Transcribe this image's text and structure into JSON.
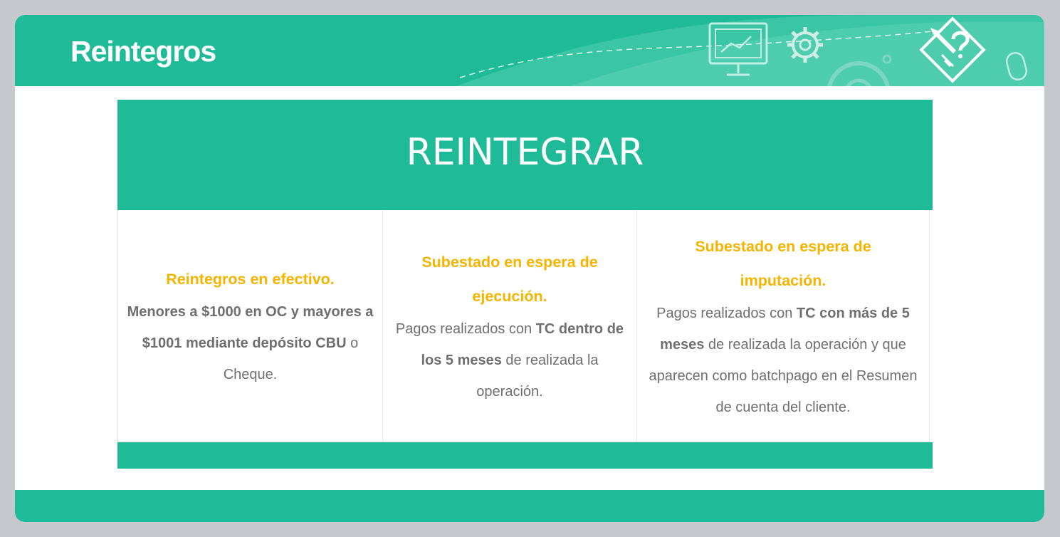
{
  "header": {
    "brand": "Reintegros",
    "logo_icon": "pencil-question-diamond-icon",
    "decor_icons": [
      "monitor-chart-icon",
      "gear-icon",
      "cog-large-icon",
      "mouse-icon"
    ]
  },
  "card": {
    "title": "REINTEGRAR",
    "columns": [
      {
        "title": "Reintegros en efectivo.",
        "body": [
          {
            "text": "Menores a $1000 en OC y mayores a $1001 mediante depósito CBU",
            "bold": true
          },
          {
            "text": " o Cheque.",
            "bold": false
          }
        ]
      },
      {
        "title": "Subestado en espera de ejecución.",
        "body": [
          {
            "text": "Pagos realizados con ",
            "bold": false
          },
          {
            "text": "TC dentro de los 5 meses",
            "bold": true
          },
          {
            "text": " de realizada la operación.",
            "bold": false
          }
        ]
      },
      {
        "title": "Subestado en espera de imputación.",
        "body": [
          {
            "text": "Pagos realizados con ",
            "bold": false
          },
          {
            "text": "TC con más de 5 meses",
            "bold": true
          },
          {
            "text": "  de realizada la operación y que aparecen como batchpago en el Resumen de cuenta del cliente.",
            "bold": false
          }
        ]
      }
    ]
  },
  "colors": {
    "accent": "#1fbb98",
    "highlight": "#f5b400",
    "body_text": "#6f6f6f",
    "backdrop": "#c5c8cc"
  }
}
